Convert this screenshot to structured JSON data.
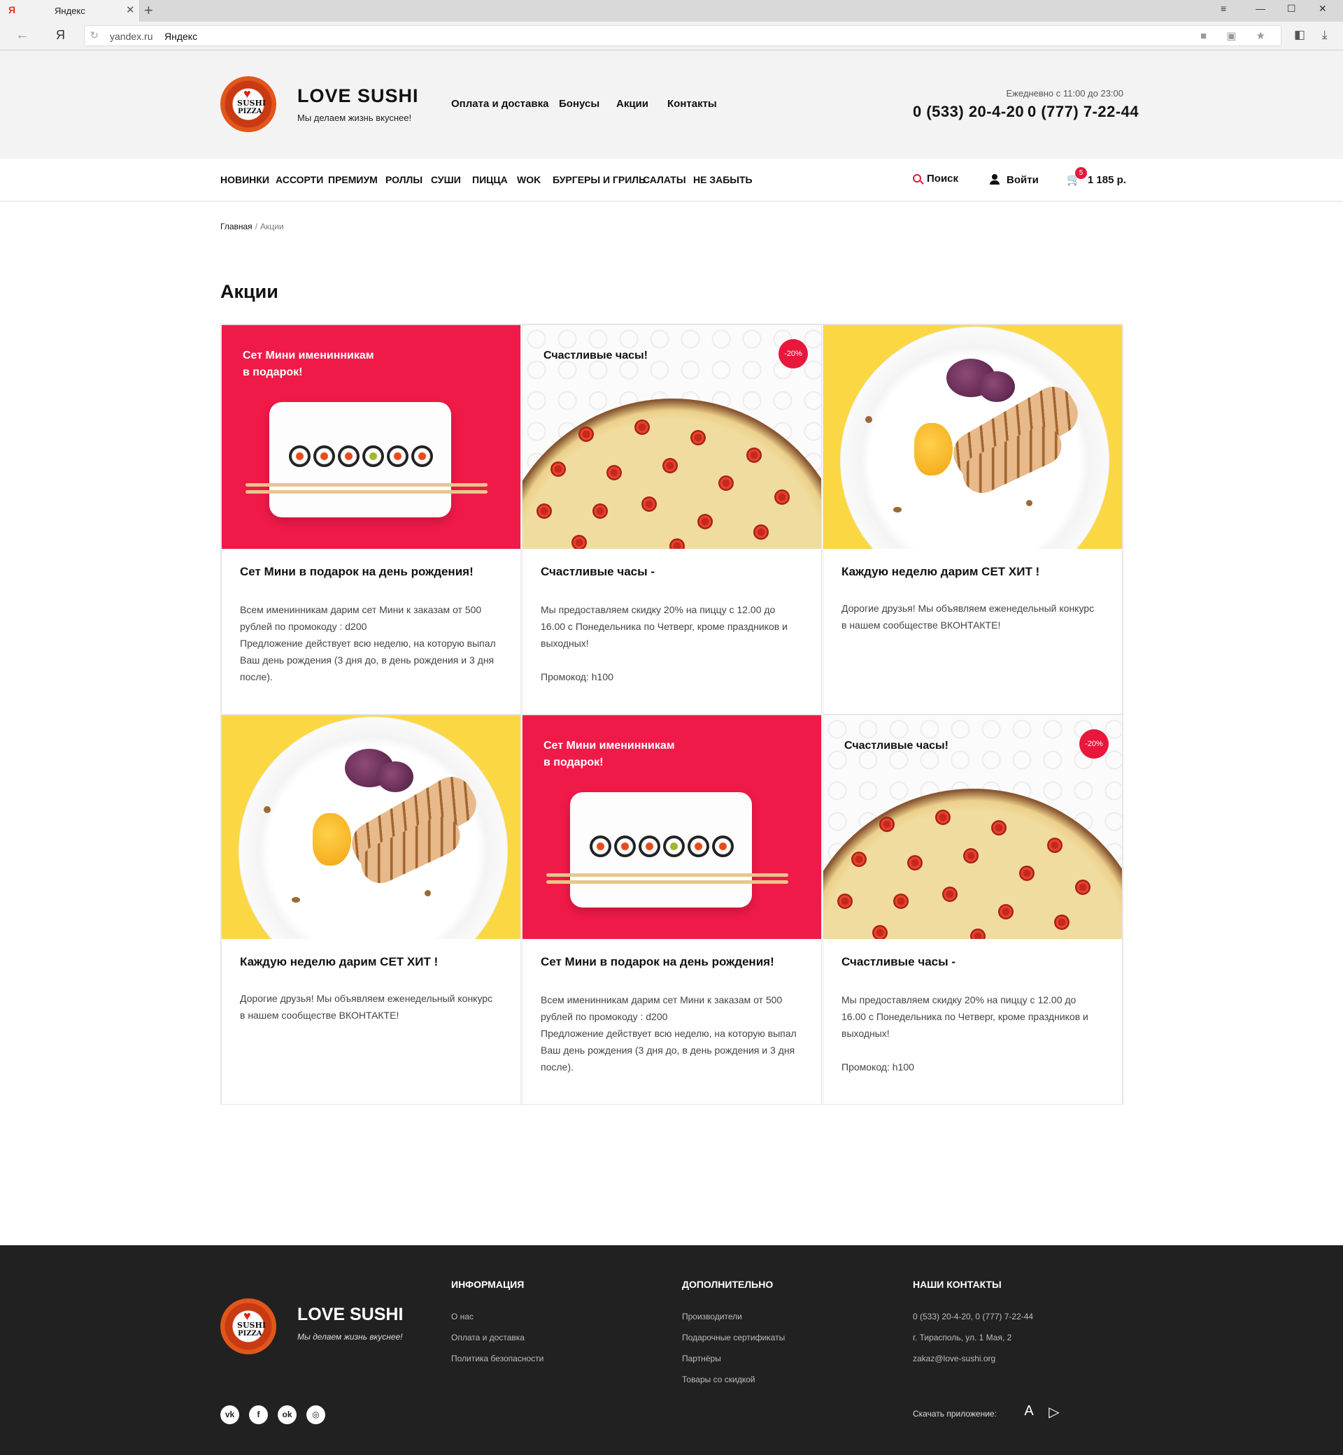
{
  "browser": {
    "tab_title": "Яндекс",
    "tab_favicon": "Я",
    "tab_close": "✕",
    "tab_new": "+",
    "win_menu": "≡",
    "win_min": "—",
    "win_max": "☐",
    "win_close": "✕",
    "back_icon": "←",
    "ya_label": "Я",
    "reload_icon": "↻",
    "address_domain": "yandex.ru",
    "address_title": "Яндекс",
    "addr_icons": "■ ▣ ★",
    "ext_icon": "◧",
    "download_icon": "⤓"
  },
  "header": {
    "logo": {
      "heart": "♥",
      "line1": "SUSHI",
      "line2": "PIZZA"
    },
    "brand": "LOVE SUSHI",
    "tagline": "Мы делаем жизнь вкуснее!",
    "menu": [
      "Оплата и доставка",
      "Бонусы",
      "Акции",
      "Контакты"
    ],
    "hours": "Ежедневно с 11:00 до 23:00",
    "phones": [
      "0 (533) 20-4-20",
      "0 (777) 7-22-44"
    ]
  },
  "categories": [
    "Новинки",
    "Ассорти",
    "Премиум",
    "Роллы",
    "Суши",
    "Пицца",
    "WOK",
    "Бургеры и гриль",
    "Салаты",
    "Не забыть"
  ],
  "tools": {
    "search": "Поиск",
    "login": "Войти",
    "cart_icon": "🛒",
    "cart_count": "5",
    "cart_total": "1 185 р."
  },
  "breadcrumb": {
    "home": "Главная",
    "separator": "/",
    "current": "Акции"
  },
  "page_title": "Акции",
  "promos": [
    {
      "image": "sushi-set",
      "caption": "Сет Мини именинникам\nв подарок!",
      "badge": "",
      "title": "Сет Мини в подарок на день рождения!",
      "text": "Всем именинникам дарим сет Мини к заказам от 500 рублей по промокоду : d200\nПредложение действует всю неделю, на которую выпал Ваш день рождения (3 дня до, в день рождения и 3 дня после)."
    },
    {
      "image": "pizza",
      "caption": "Счастливые часы!",
      "badge": "-20%",
      "title": "Счастливые часы -",
      "text": "Мы предоставляем скидку 20% на пиццу с 12.00 до 16.00 с Понедельника по Четверг, кроме праздников и выходных!\n\nПромокод: h100"
    },
    {
      "image": "grill-plate",
      "caption": "",
      "badge": "",
      "title": "Каждую неделю дарим СЕТ ХИТ !",
      "text": "Дорогие друзья! Мы объявляем еженедельный конкурс в нашем сообществе ВКОНТАКТЕ!"
    },
    {
      "image": "grill-plate",
      "caption": "",
      "badge": "",
      "title": "Каждую неделю дарим СЕТ ХИТ !",
      "text": "Дорогие друзья! Мы объявляем еженедельный конкурс в нашем сообществе ВКОНТАКТЕ!"
    },
    {
      "image": "sushi-set",
      "caption": "Сет Мини именинникам\nв подарок!",
      "badge": "",
      "title": "Сет Мини в подарок на день рождения!",
      "text": "Всем именинникам дарим сет Мини к заказам от 500 рублей по промокоду : d200\nПредложение действует всю неделю, на которую выпал Ваш день рождения (3 дня до, в день рождения и 3 дня после)."
    },
    {
      "image": "pizza",
      "caption": "Счастливые часы!",
      "badge": "-20%",
      "title": "Счастливые часы -",
      "text": "Мы предоставляем скидку 20% на пиццу с 12.00 до 16.00 с Понедельника по Четверг, кроме праздников и выходных!\n\nПромокод: h100"
    }
  ],
  "footer": {
    "brand": "LOVE SUSHI",
    "tagline": "Мы делаем жизнь вкуснее!",
    "info_title": "Информация",
    "info_links": [
      "О нас",
      "Оплата и доставка",
      "Политика безопасности"
    ],
    "extra_title": "Дополнительно",
    "extra_links": [
      "Производители",
      "Подарочные сертификаты",
      "Партнёры",
      "Товары со скидкой"
    ],
    "contacts_title": "Наши контакты",
    "contacts": [
      "0 (533) 20-4-20, 0 (777) 7-22-44",
      "г. Тирасполь, ул. 1 Мая, 2",
      "zakaz@love-sushi.org"
    ],
    "social": [
      "vk",
      "f",
      "ok",
      "◎"
    ],
    "app_label": "Скачать приложение:",
    "app_icons": [
      "A",
      "▷"
    ]
  },
  "colors": {
    "accent": "#e8173c",
    "promo_pink": "#f01a48",
    "promo_yellow": "#fbd843",
    "footer_bg": "#212121"
  }
}
